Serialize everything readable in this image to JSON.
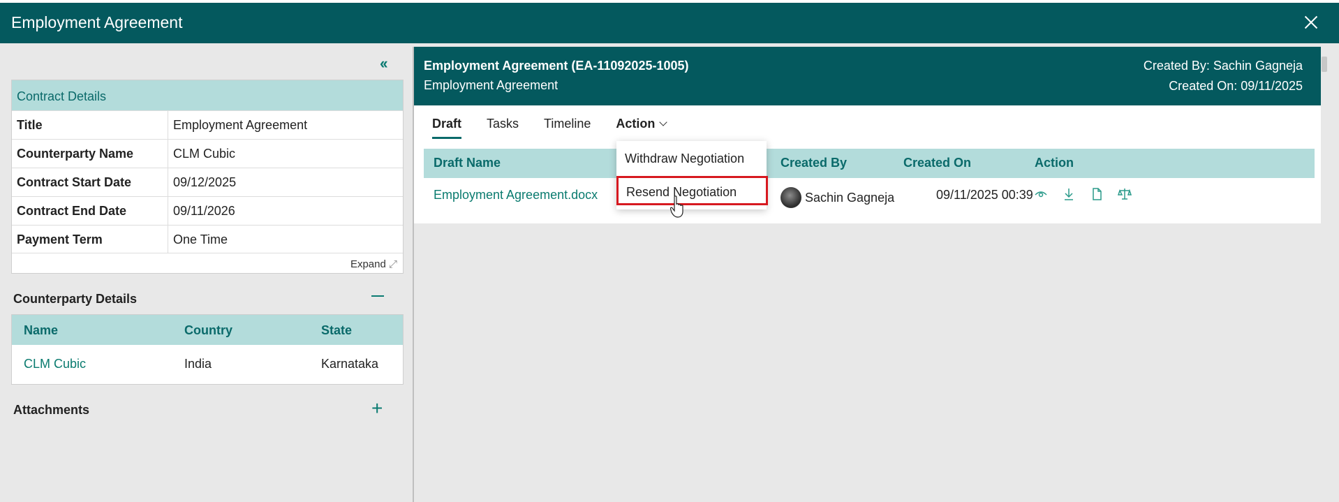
{
  "window": {
    "title": "Employment Agreement"
  },
  "contract_details": {
    "heading": "Contract Details",
    "rows": [
      {
        "label": "Title",
        "value": "Employment Agreement"
      },
      {
        "label": "Counterparty Name",
        "value": "CLM Cubic"
      },
      {
        "label": "Contract Start Date",
        "value": "09/12/2025"
      },
      {
        "label": "Contract End Date",
        "value": "09/11/2026"
      },
      {
        "label": "Payment Term",
        "value": "One Time"
      }
    ],
    "expand_label": "Expand"
  },
  "counterparty": {
    "heading": "Counterparty Details",
    "columns": [
      "Name",
      "Country",
      "State"
    ],
    "rows": [
      {
        "name": "CLM Cubic",
        "country": "India",
        "state": "Karnataka"
      }
    ]
  },
  "attachments": {
    "heading": "Attachments"
  },
  "header": {
    "title": "Employment Agreement (EA-11092025-1005)",
    "subtitle": "Employment Agreement",
    "created_by": "Created By: Sachin Gagneja",
    "created_on": "Created On: 09/11/2025"
  },
  "tabs": [
    "Draft",
    "Tasks",
    "Timeline",
    "Action"
  ],
  "drafts": {
    "columns": [
      "Draft Name",
      "Created By",
      "Created On",
      "Action"
    ],
    "rows": [
      {
        "name": "Employment Agreement.docx",
        "created_by": "Sachin Gagneja",
        "created_on": "09/11/2025 00:39"
      }
    ]
  },
  "action_menu": {
    "items": [
      "Withdraw Negotiation",
      "Resend Negotiation"
    ],
    "highlighted": "Resend Negotiation"
  },
  "colors": {
    "header": "#04595e",
    "table_head": "#b3dcdb",
    "accent": "#0a7b6f",
    "highlight": "#d71920"
  },
  "icons": [
    "close-icon",
    "collapse-icon",
    "expand-icon",
    "minus-icon",
    "plus-icon",
    "chevron-down-icon",
    "kebab-icon",
    "view-icon",
    "download-icon",
    "document-icon",
    "scales-icon",
    "hand-cursor-icon"
  ]
}
